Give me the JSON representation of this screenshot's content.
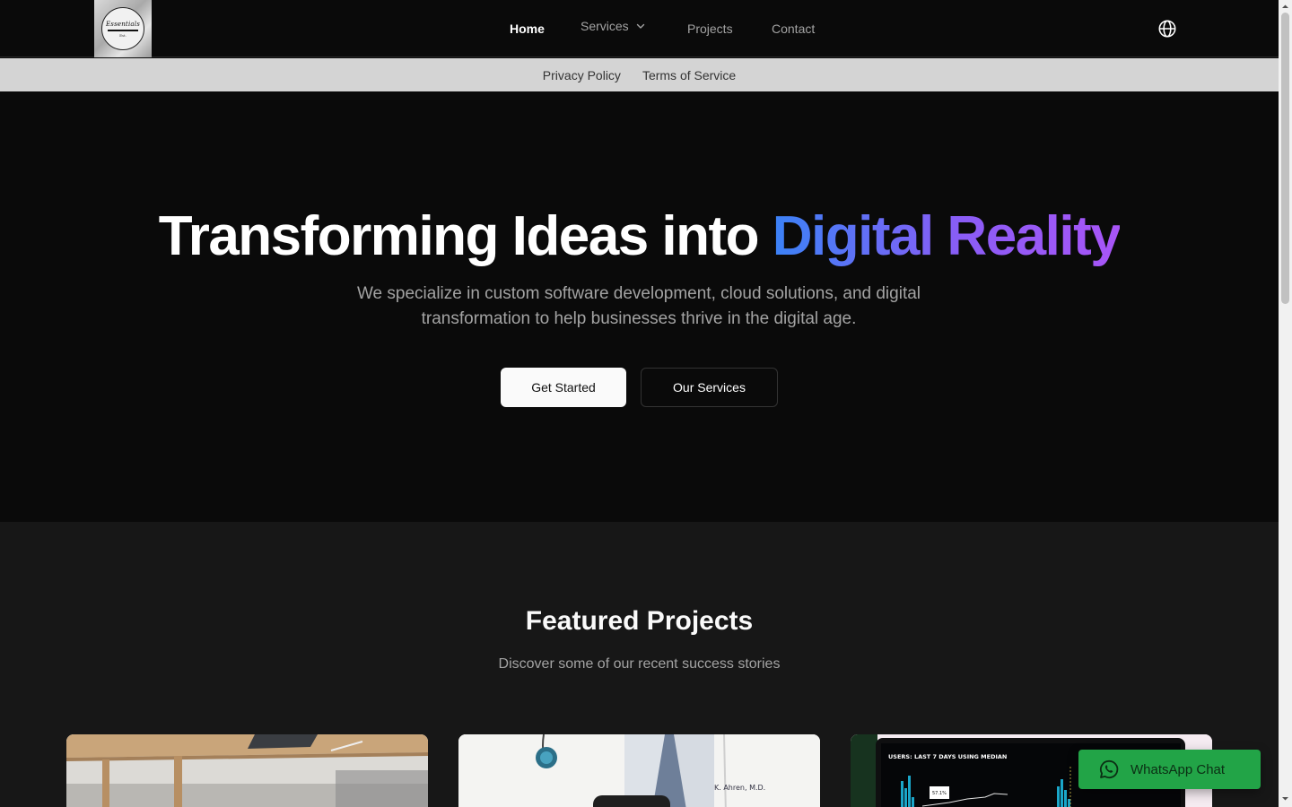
{
  "brand": {
    "logo_script": "Essentials",
    "logo_small": "Est."
  },
  "nav": {
    "home": "Home",
    "services": "Services",
    "projects": "Projects",
    "contact": "Contact"
  },
  "subnav": {
    "privacy": "Privacy Policy",
    "terms": "Terms of Service"
  },
  "hero": {
    "title_plain": "Transforming Ideas into ",
    "title_highlight": "Digital Reality",
    "subtitle": "We specialize in custom software development, cloud solutions, and digital transformation to help businesses thrive in the digital age.",
    "primary_button": "Get Started",
    "secondary_button": "Our Services"
  },
  "projects": {
    "title": "Featured Projects",
    "subtitle": "Discover some of our recent success stories",
    "cards": [
      {
        "image": "workspace desk photo"
      },
      {
        "image": "doctor with stethoscope photo"
      },
      {
        "image": "analytics dashboard on monitor photo",
        "screen_text": "USERS: LAST 7 DAYS USING MEDIAN"
      }
    ]
  },
  "whatsapp": {
    "label": "WhatsApp Chat"
  },
  "colors": {
    "background": "#0a0a0a",
    "section_background": "#171717",
    "subnav_background": "#d4d4d4",
    "gradient_start": "#3b82f6",
    "gradient_end": "#a855f7",
    "whatsapp_green": "#22a447"
  },
  "icons": {
    "language": "globe-icon",
    "services_dropdown": "chevron-down-icon",
    "whatsapp": "whatsapp-icon"
  }
}
